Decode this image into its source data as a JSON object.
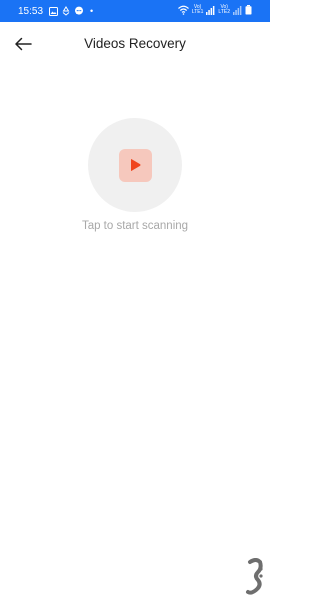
{
  "status_bar": {
    "time": "15:53",
    "dot": "•",
    "left_icons": [
      "gallery-icon",
      "recycle-icon",
      "chat-icon"
    ],
    "sim1": {
      "top": "Vo)",
      "bottom": "LTE1"
    },
    "sim2": {
      "top": "Vo)",
      "bottom": "LTE2"
    },
    "background_color": "#1a73f5"
  },
  "header": {
    "back_icon": "arrow-left-icon",
    "title": "Videos Recovery"
  },
  "main": {
    "scan_button_icon": "play-icon",
    "hint": "Tap to start scanning",
    "accent_color": "#f0441c",
    "tile_color": "#f6c8bd"
  }
}
